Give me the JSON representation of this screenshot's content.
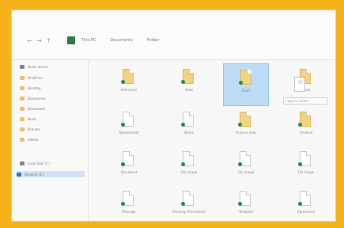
{
  "colors": {
    "frame": "#f5b21a",
    "selection": "#bcdcf5",
    "accent": "#2d78c5"
  },
  "nav": {
    "back": "←",
    "forward": "→",
    "up": "↑"
  },
  "breadcrumb": [
    "This PC",
    "Documents",
    "Folder"
  ],
  "sidebar": [
    {
      "label": "Quick access",
      "icon": "star-icon"
    },
    {
      "label": "OneDrive",
      "icon": "cloud-icon"
    },
    {
      "label": "Desktop",
      "icon": "folder-icon"
    },
    {
      "label": "Documents",
      "icon": "folder-icon"
    },
    {
      "label": "Downloads",
      "icon": "folder-icon"
    },
    {
      "label": "Music",
      "icon": "folder-icon"
    },
    {
      "label": "Pictures",
      "icon": "folder-icon"
    },
    {
      "label": "Videos",
      "icon": "folder-icon"
    },
    {
      "label": "Local Disk (C:)",
      "icon": "drive-icon"
    },
    {
      "label": "Network (E:)",
      "icon": "network-icon",
      "selected": true
    }
  ],
  "files": [
    {
      "name": "Reference",
      "type": "yellow"
    },
    {
      "name": "Stats",
      "type": "yellow"
    },
    {
      "name": "Draft",
      "type": "yellow",
      "selected": true
    },
    {
      "name": "Photo",
      "type": "yellow"
    },
    {
      "name": "Spreadsheet",
      "type": "doc"
    },
    {
      "name": "Notes",
      "type": "doc"
    },
    {
      "name": "Finance data",
      "type": "yellow"
    },
    {
      "name": "Timeline",
      "type": "yellow"
    },
    {
      "name": "Document",
      "type": "doc"
    },
    {
      "name": "File image",
      "type": "doc"
    },
    {
      "name": "File image",
      "type": "doc"
    },
    {
      "name": "File image",
      "type": "doc"
    },
    {
      "name": "Message",
      "type": "doc"
    },
    {
      "name": "Meeting (Scheduled)",
      "type": "doc"
    },
    {
      "name": "Template",
      "type": "doc"
    },
    {
      "name": "Agreement",
      "type": "doc"
    }
  ],
  "drag": {
    "label": "Copy to Folder"
  }
}
